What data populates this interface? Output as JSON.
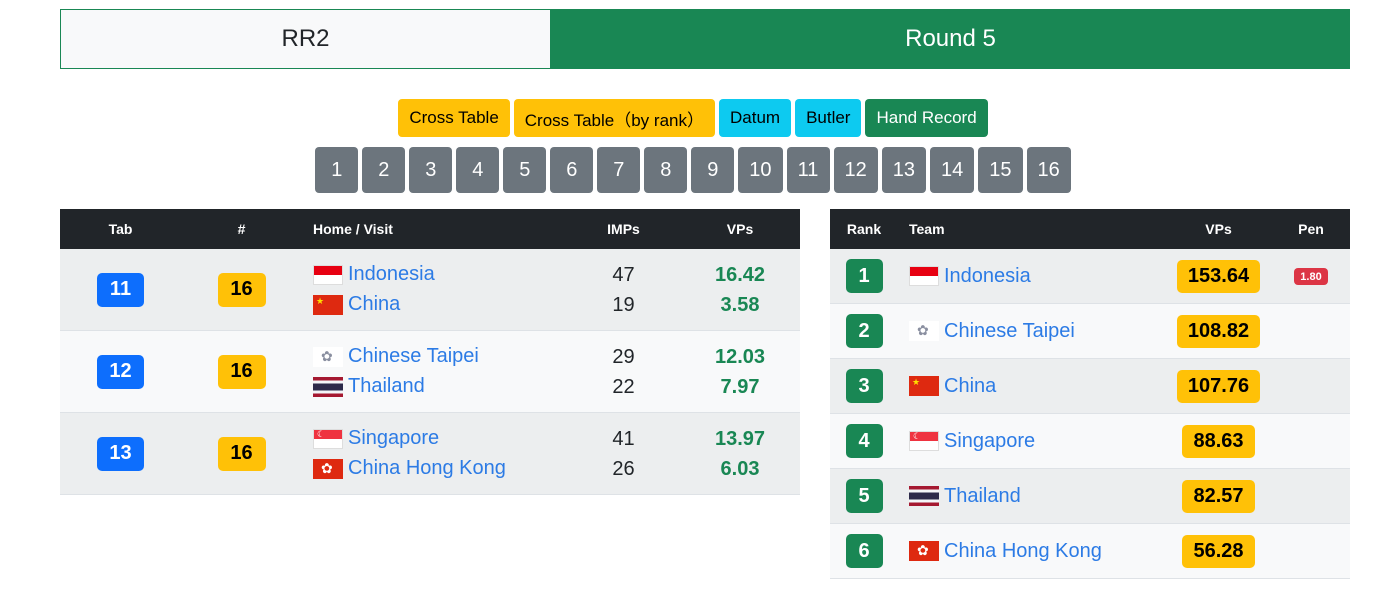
{
  "header": {
    "left": "RR2",
    "right": "Round 5"
  },
  "buttons": [
    {
      "label": "Cross Table",
      "style": "warning"
    },
    {
      "label": "Cross Table（by rank）",
      "style": "warning"
    },
    {
      "label": "Datum",
      "style": "info"
    },
    {
      "label": "Butler",
      "style": "info"
    },
    {
      "label": "Hand Record",
      "style": "success"
    }
  ],
  "pages": [
    "1",
    "2",
    "3",
    "4",
    "5",
    "6",
    "7",
    "8",
    "9",
    "10",
    "11",
    "12",
    "13",
    "14",
    "15",
    "16"
  ],
  "matches": {
    "headers": {
      "tab": "Tab",
      "num": "#",
      "teams": "Home / Visit",
      "imps": "IMPs",
      "vps": "VPs"
    },
    "rows": [
      {
        "tab": "11",
        "num": "16",
        "home": {
          "name": "Indonesia",
          "flag": "id-flag-icon",
          "imps": "47",
          "vps": "16.42"
        },
        "visit": {
          "name": "China",
          "flag": "cn-flag-icon",
          "imps": "19",
          "vps": "3.58"
        }
      },
      {
        "tab": "12",
        "num": "16",
        "home": {
          "name": "Chinese Taipei",
          "flag": "tw-flag-icon",
          "imps": "29",
          "vps": "12.03"
        },
        "visit": {
          "name": "Thailand",
          "flag": "th-flag-icon",
          "imps": "22",
          "vps": "7.97"
        }
      },
      {
        "tab": "13",
        "num": "16",
        "home": {
          "name": "Singapore",
          "flag": "sg-flag-icon",
          "imps": "41",
          "vps": "13.97"
        },
        "visit": {
          "name": "China Hong Kong",
          "flag": "hk-flag-icon",
          "imps": "26",
          "vps": "6.03"
        }
      }
    ]
  },
  "ranking": {
    "headers": {
      "rank": "Rank",
      "team": "Team",
      "vps": "VPs",
      "pen": "Pen"
    },
    "rows": [
      {
        "rank": "1",
        "team": "Indonesia",
        "flag": "id-flag-icon",
        "vps": "153.64",
        "pen": "1.80"
      },
      {
        "rank": "2",
        "team": "Chinese Taipei",
        "flag": "tw-flag-icon",
        "vps": "108.82",
        "pen": ""
      },
      {
        "rank": "3",
        "team": "China",
        "flag": "cn-flag-icon",
        "vps": "107.76",
        "pen": ""
      },
      {
        "rank": "4",
        "team": "Singapore",
        "flag": "sg-flag-icon",
        "vps": "88.63",
        "pen": ""
      },
      {
        "rank": "5",
        "team": "Thailand",
        "flag": "th-flag-icon",
        "vps": "82.57",
        "pen": ""
      },
      {
        "rank": "6",
        "team": "China Hong Kong",
        "flag": "hk-flag-icon",
        "vps": "56.28",
        "pen": ""
      }
    ]
  },
  "colors": {
    "success": "#198754",
    "warning": "#ffc107",
    "info": "#0dcaf0",
    "primary": "#0d6efd",
    "secondary": "#6c757d",
    "danger": "#dc3545",
    "dark": "#212529"
  }
}
